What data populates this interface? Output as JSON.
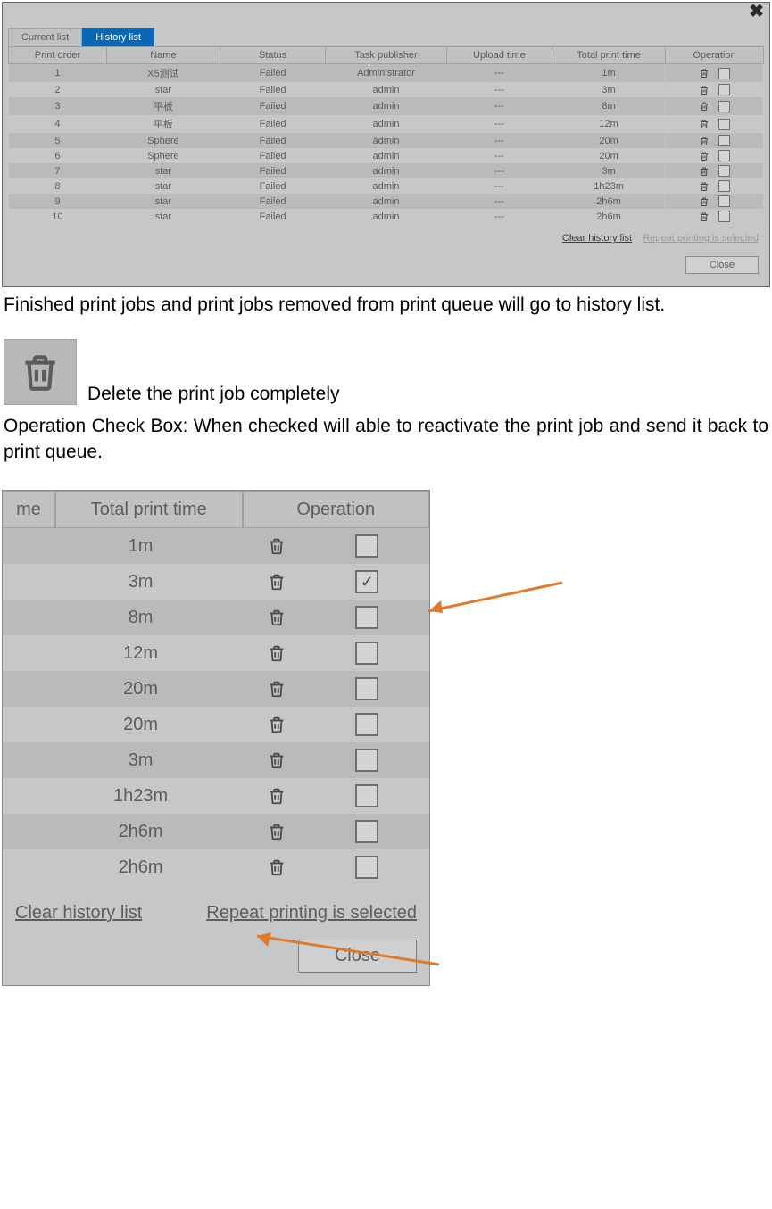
{
  "dialog": {
    "tabs": {
      "current": "Current list",
      "history": "History list"
    },
    "columns": [
      "Print order",
      "Name",
      "Status",
      "Task publisher",
      "Upload time",
      "Total print time",
      "Operation"
    ],
    "rows": [
      {
        "order": "1",
        "name": "X5测试",
        "status": "Failed",
        "publisher": "Administrator",
        "upload": "---",
        "time": "1m"
      },
      {
        "order": "2",
        "name": "star",
        "status": "Failed",
        "publisher": "admin",
        "upload": "---",
        "time": "3m"
      },
      {
        "order": "3",
        "name": "平板",
        "status": "Failed",
        "publisher": "admin",
        "upload": "---",
        "time": "8m"
      },
      {
        "order": "4",
        "name": "平板",
        "status": "Failed",
        "publisher": "admin",
        "upload": "---",
        "time": "12m"
      },
      {
        "order": "5",
        "name": "Sphere",
        "status": "Failed",
        "publisher": "admin",
        "upload": "---",
        "time": "20m"
      },
      {
        "order": "6",
        "name": "Sphere",
        "status": "Failed",
        "publisher": "admin",
        "upload": "---",
        "time": "20m"
      },
      {
        "order": "7",
        "name": "star",
        "status": "Failed",
        "publisher": "admin",
        "upload": "---",
        "time": "3m"
      },
      {
        "order": "8",
        "name": "star",
        "status": "Failed",
        "publisher": "admin",
        "upload": "---",
        "time": "1h23m"
      },
      {
        "order": "9",
        "name": "star",
        "status": "Failed",
        "publisher": "admin",
        "upload": "---",
        "time": "2h6m"
      },
      {
        "order": "10",
        "name": "star",
        "status": "Failed",
        "publisher": "admin",
        "upload": "---",
        "time": "2h6m"
      }
    ],
    "clear": "Clear history list",
    "repeat": "Repeat printing is selected",
    "close": "Close"
  },
  "prose": {
    "p1": "Finished print jobs and print jobs removed from print queue will go to history list.",
    "delete_caption": "Delete the print job completely",
    "p2": "Operation Check Box: When checked will able to reactivate the print job and send it back to print queue."
  },
  "crop": {
    "head_me": "me",
    "head_time": "Total print time",
    "head_op": "Operation",
    "rows": [
      {
        "time": "1m",
        "checked": false
      },
      {
        "time": "3m",
        "checked": true
      },
      {
        "time": "8m",
        "checked": false
      },
      {
        "time": "12m",
        "checked": false
      },
      {
        "time": "20m",
        "checked": false
      },
      {
        "time": "20m",
        "checked": false
      },
      {
        "time": "3m",
        "checked": false
      },
      {
        "time": "1h23m",
        "checked": false
      },
      {
        "time": "2h6m",
        "checked": false
      },
      {
        "time": "2h6m",
        "checked": false
      }
    ],
    "clear": "Clear history list",
    "repeat": "Repeat printing is selected",
    "close": "Close"
  }
}
